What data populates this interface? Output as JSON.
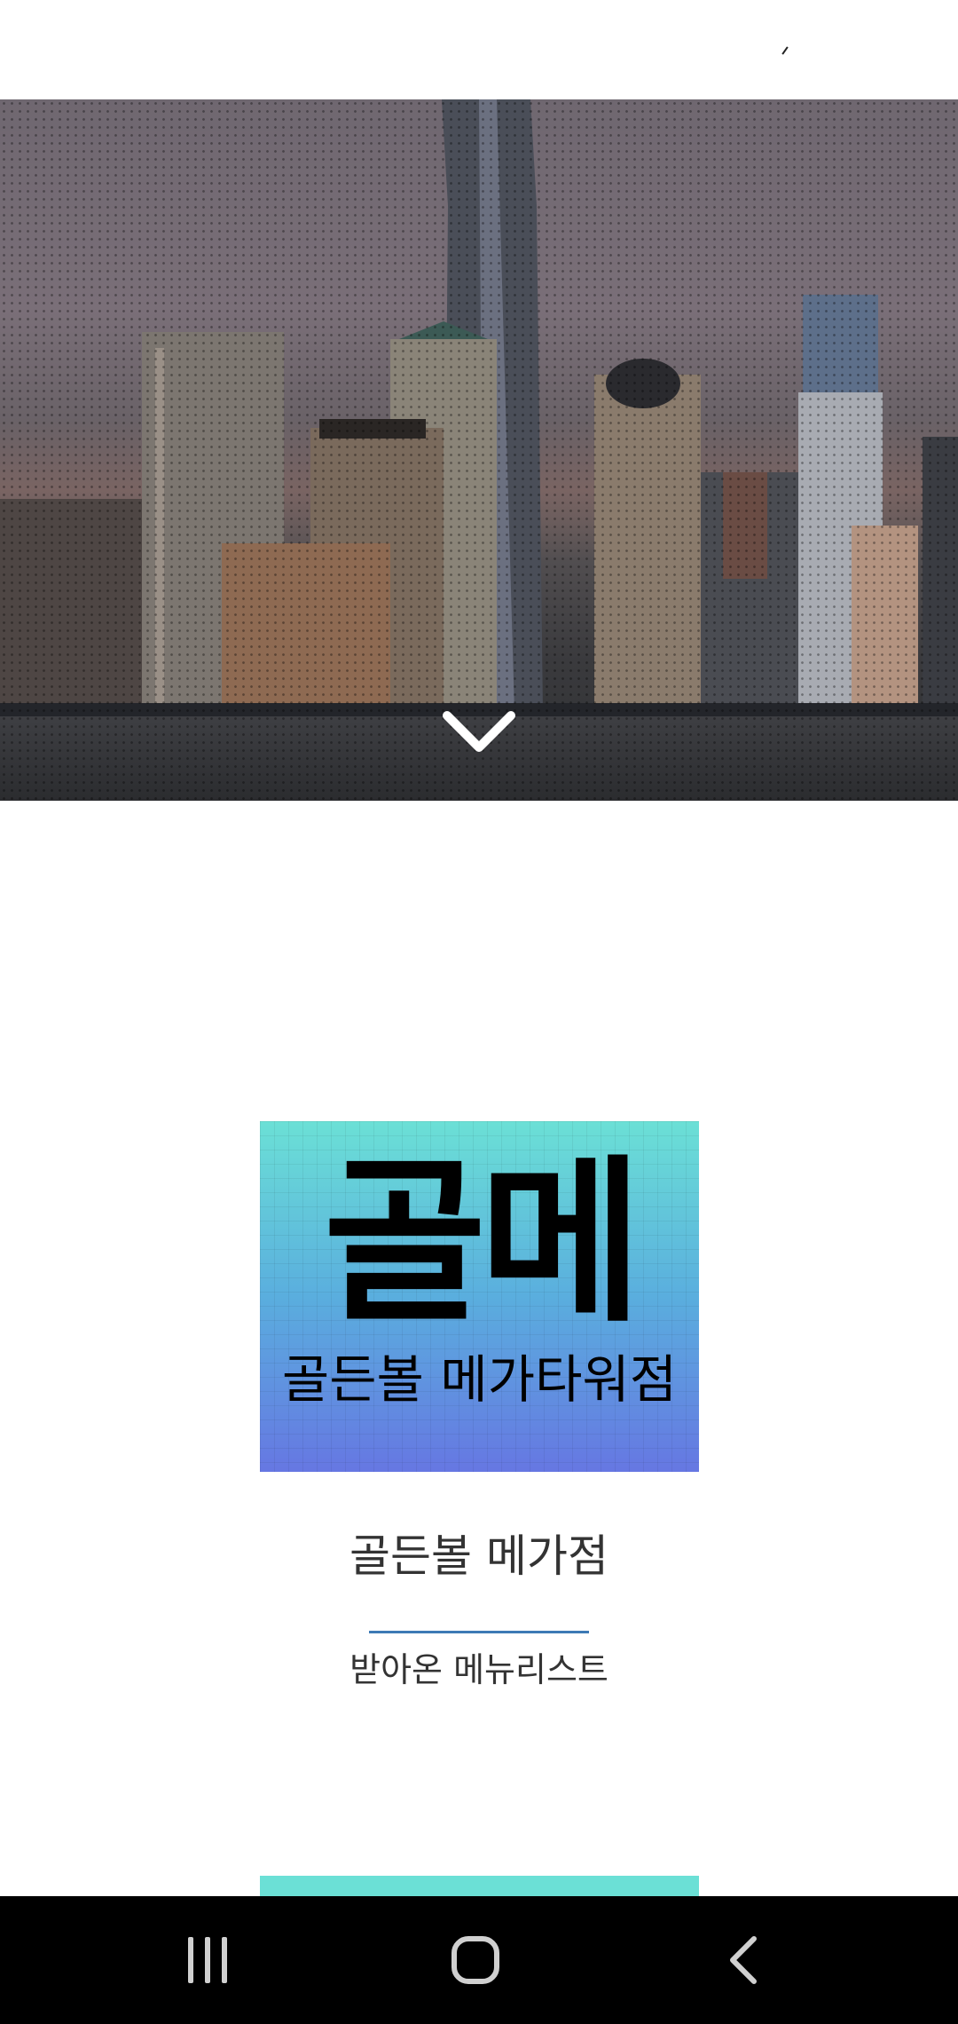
{
  "hero": {
    "image": "city-skyline-photo",
    "scroll_icon": "chevron-down-icon"
  },
  "menu_card": {
    "logo_text": "골메",
    "subtitle": "골든볼  메가타워점",
    "colors": {
      "top": "#6be0d6",
      "middle": "#5aaede",
      "bottom": "#6677e2"
    }
  },
  "store": {
    "title": "골든볼 메가점",
    "caption": "받아온 메뉴리스트",
    "divider_color": "#3d7ab5"
  },
  "nav_bar": {
    "recent_apps_icon": "recent-apps-icon",
    "home_icon": "home-icon",
    "back_icon": "back-icon"
  }
}
